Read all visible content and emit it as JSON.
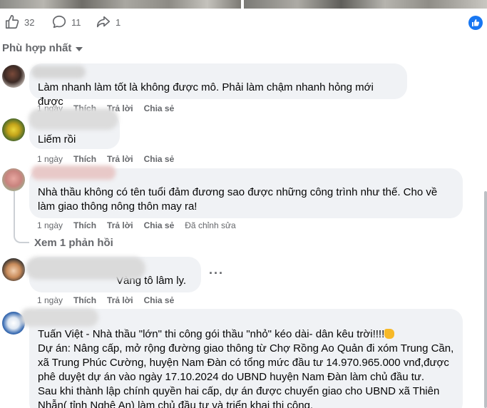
{
  "reactions": {
    "likes": "32",
    "comments": "11",
    "shares": "1"
  },
  "sort_label": "Phù hợp nhất",
  "comments": [
    {
      "text": "Làm nhanh làm tốt là không được mô. Phải làm chậm nhanh hỏng mới được",
      "time": "1 ngày",
      "like": "Thích",
      "reply": "Trả lời",
      "share": "Chia sẻ"
    },
    {
      "text_top": "Liếm rồi",
      "time": "1 ngày",
      "like": "Thích",
      "reply": "Trả lời",
      "share": "Chia sẻ"
    },
    {
      "line1": "Nhà thầu không có tên tuổi đảm đương sao được những công trình như thế. Cho về",
      "line2": "làm giao thông nông thôn may ra!",
      "time": "1 ngày",
      "like": "Thích",
      "reply": "Trả lời",
      "share": "Chia sẻ",
      "edited": "Đã chỉnh sửa",
      "view_replies": "Xem 1 phản hồi"
    },
    {
      "text": "Vàng tô lâm ly.",
      "time": "1 ngày",
      "like": "Thích",
      "reply": "Trả lời",
      "share": "Chia sẻ",
      "more": "···"
    },
    {
      "line1": "Tuấn Việt - Nhà thầu \"lớn\" thi công gói thầu \"nhỏ\" kéo dài- dân kêu trời!!!!",
      "line2": "Dự án: Nâng cấp, mở rộng đường giao thông từ Chợ Rồng Ao Quản đi xóm Trung Cần,",
      "line3": "xã Trung Phúc Cường, huyện Nam Đàn có tổng mức đầu tư 14.970.965.000 vnđ,được",
      "line4": "phê duyệt dự án vào ngày 17.10.2024 do UBND huyện Nam Đàn làm chủ đầu tư.",
      "line5": "Sau khi thành lập chính quyền hai cấp, dự án được chuyển giao cho UBND xã Thiên",
      "line6": "Nhẫn( tỉnh Nghệ An) làm chủ đầu tư và triển khai thi công."
    }
  ]
}
